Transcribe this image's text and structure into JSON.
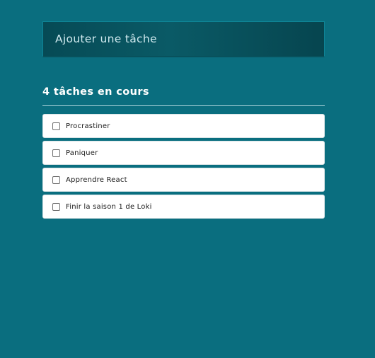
{
  "add_task": {
    "placeholder": "Ajouter une tâche"
  },
  "task_count_title": "4 tâches en cours",
  "tasks": [
    {
      "label": "Procrastiner",
      "checked": false
    },
    {
      "label": "Paniquer",
      "checked": false
    },
    {
      "label": "Apprendre React",
      "checked": false
    },
    {
      "label": "Finir la saison 1 de Loki",
      "checked": false
    }
  ],
  "colors": {
    "background": "#0a6e7f",
    "input_background": "#064a55",
    "divider": "#a9d3da",
    "task_background": "#ffffff"
  }
}
